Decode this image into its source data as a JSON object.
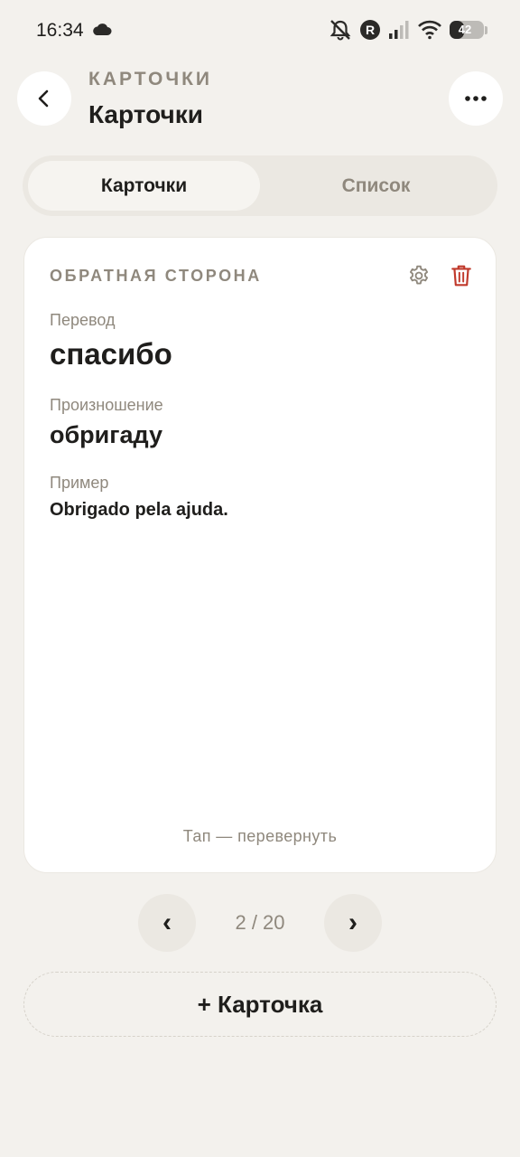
{
  "status_bar": {
    "time": "16:34",
    "battery": "42",
    "battery_level": 0.42,
    "icons": [
      "cloud-icon",
      "mute-icon",
      "r-badge-icon",
      "signal-icon",
      "wifi-icon",
      "battery-icon"
    ]
  },
  "header": {
    "overline": "КАРТОЧКИ",
    "title": "Карточки",
    "back_icon": "chevron-left-icon",
    "more_icon": "more-horizontal-icon"
  },
  "tabs": [
    {
      "label": "Карточки",
      "active": true
    },
    {
      "label": "Список",
      "active": false
    }
  ],
  "card": {
    "side": "ОБРАТНАЯ СТОРОНА",
    "fields": [
      {
        "label": "Перевод",
        "value": "спасибо"
      },
      {
        "label": "Произношение",
        "value": "обригаду"
      },
      {
        "label": "Пример",
        "value": "Obrigado pela ajuda."
      }
    ],
    "hint": "Тап — перевернуть",
    "gear_icon": "gear-icon",
    "delete_icon": "trash-icon",
    "delete_color": "#c0392b"
  },
  "pager": {
    "prev": "‹",
    "next": "›",
    "count": "2 / 20"
  },
  "add_button": "+ Карточка",
  "colors": {
    "background": "#f3f1ed",
    "muted": "#8f887d",
    "text": "#1f1e1c",
    "surface": "#ffffff",
    "danger": "#c0392b"
  }
}
